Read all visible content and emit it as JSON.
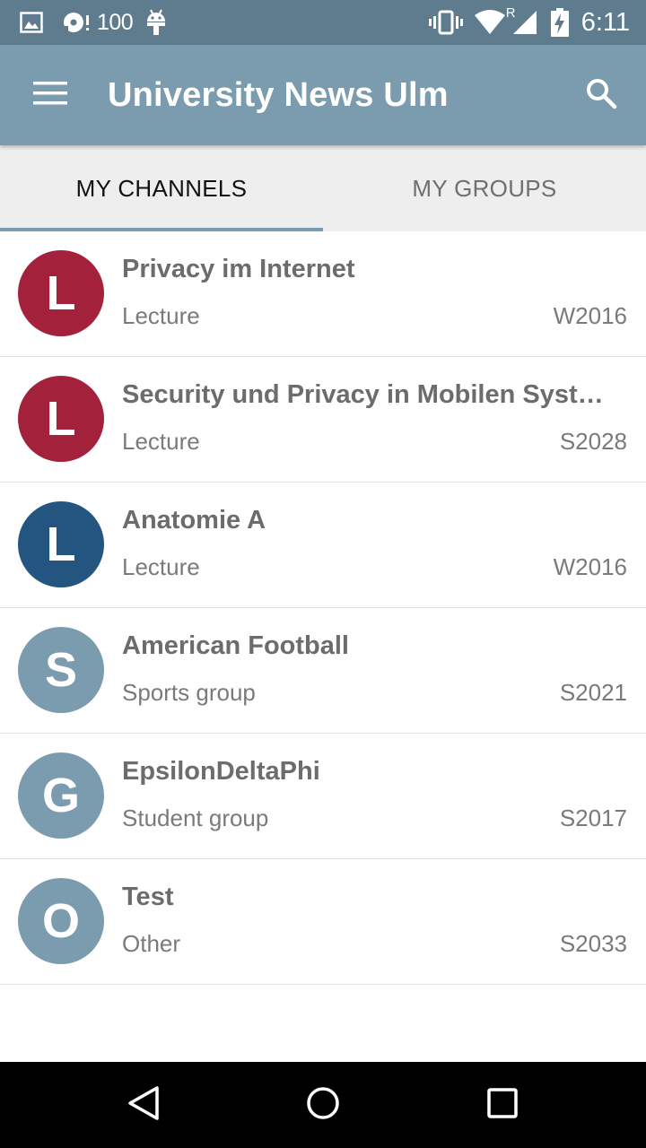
{
  "status_bar": {
    "notification_count": "100",
    "time": "6:11",
    "roaming_indicator": "R",
    "icons": [
      "image-icon",
      "media-disc-icon",
      "android-icon",
      "vibrate-icon",
      "wifi-icon",
      "signal-icon",
      "battery-charging-icon"
    ]
  },
  "app_bar": {
    "title": "University News Ulm",
    "menu_icon": "hamburger-menu-icon",
    "search_icon": "search-icon",
    "color": "#7b9cae"
  },
  "tabs": [
    {
      "label": "MY CHANNELS",
      "selected": true
    },
    {
      "label": "MY GROUPS",
      "selected": false
    }
  ],
  "channels": [
    {
      "letter": "L",
      "title": "Privacy im Internet",
      "type": "Lecture",
      "term": "W2016",
      "color": "#a3213a"
    },
    {
      "letter": "L",
      "title": "Security und Privacy in Mobilen Syst…",
      "type": "Lecture",
      "term": "S2028",
      "color": "#a3213a"
    },
    {
      "letter": "L",
      "title": "Anatomie A",
      "type": "Lecture",
      "term": "W2016",
      "color": "#235580"
    },
    {
      "letter": "S",
      "title": "American Football",
      "type": "Sports group",
      "term": "S2021",
      "color": "#7b9cae"
    },
    {
      "letter": "G",
      "title": "EpsilonDeltaPhi",
      "type": "Student group",
      "term": "S2017",
      "color": "#7b9cae"
    },
    {
      "letter": "O",
      "title": "Test",
      "type": "Other",
      "term": "S2033",
      "color": "#7b9cae"
    }
  ],
  "nav_bar": {
    "icons": [
      "back-icon",
      "home-icon",
      "recents-icon"
    ]
  },
  "colors": {
    "status_bar": "#5e7c8d",
    "tab_background": "#eeeeee",
    "tab_indicator": "#7b9cae"
  }
}
